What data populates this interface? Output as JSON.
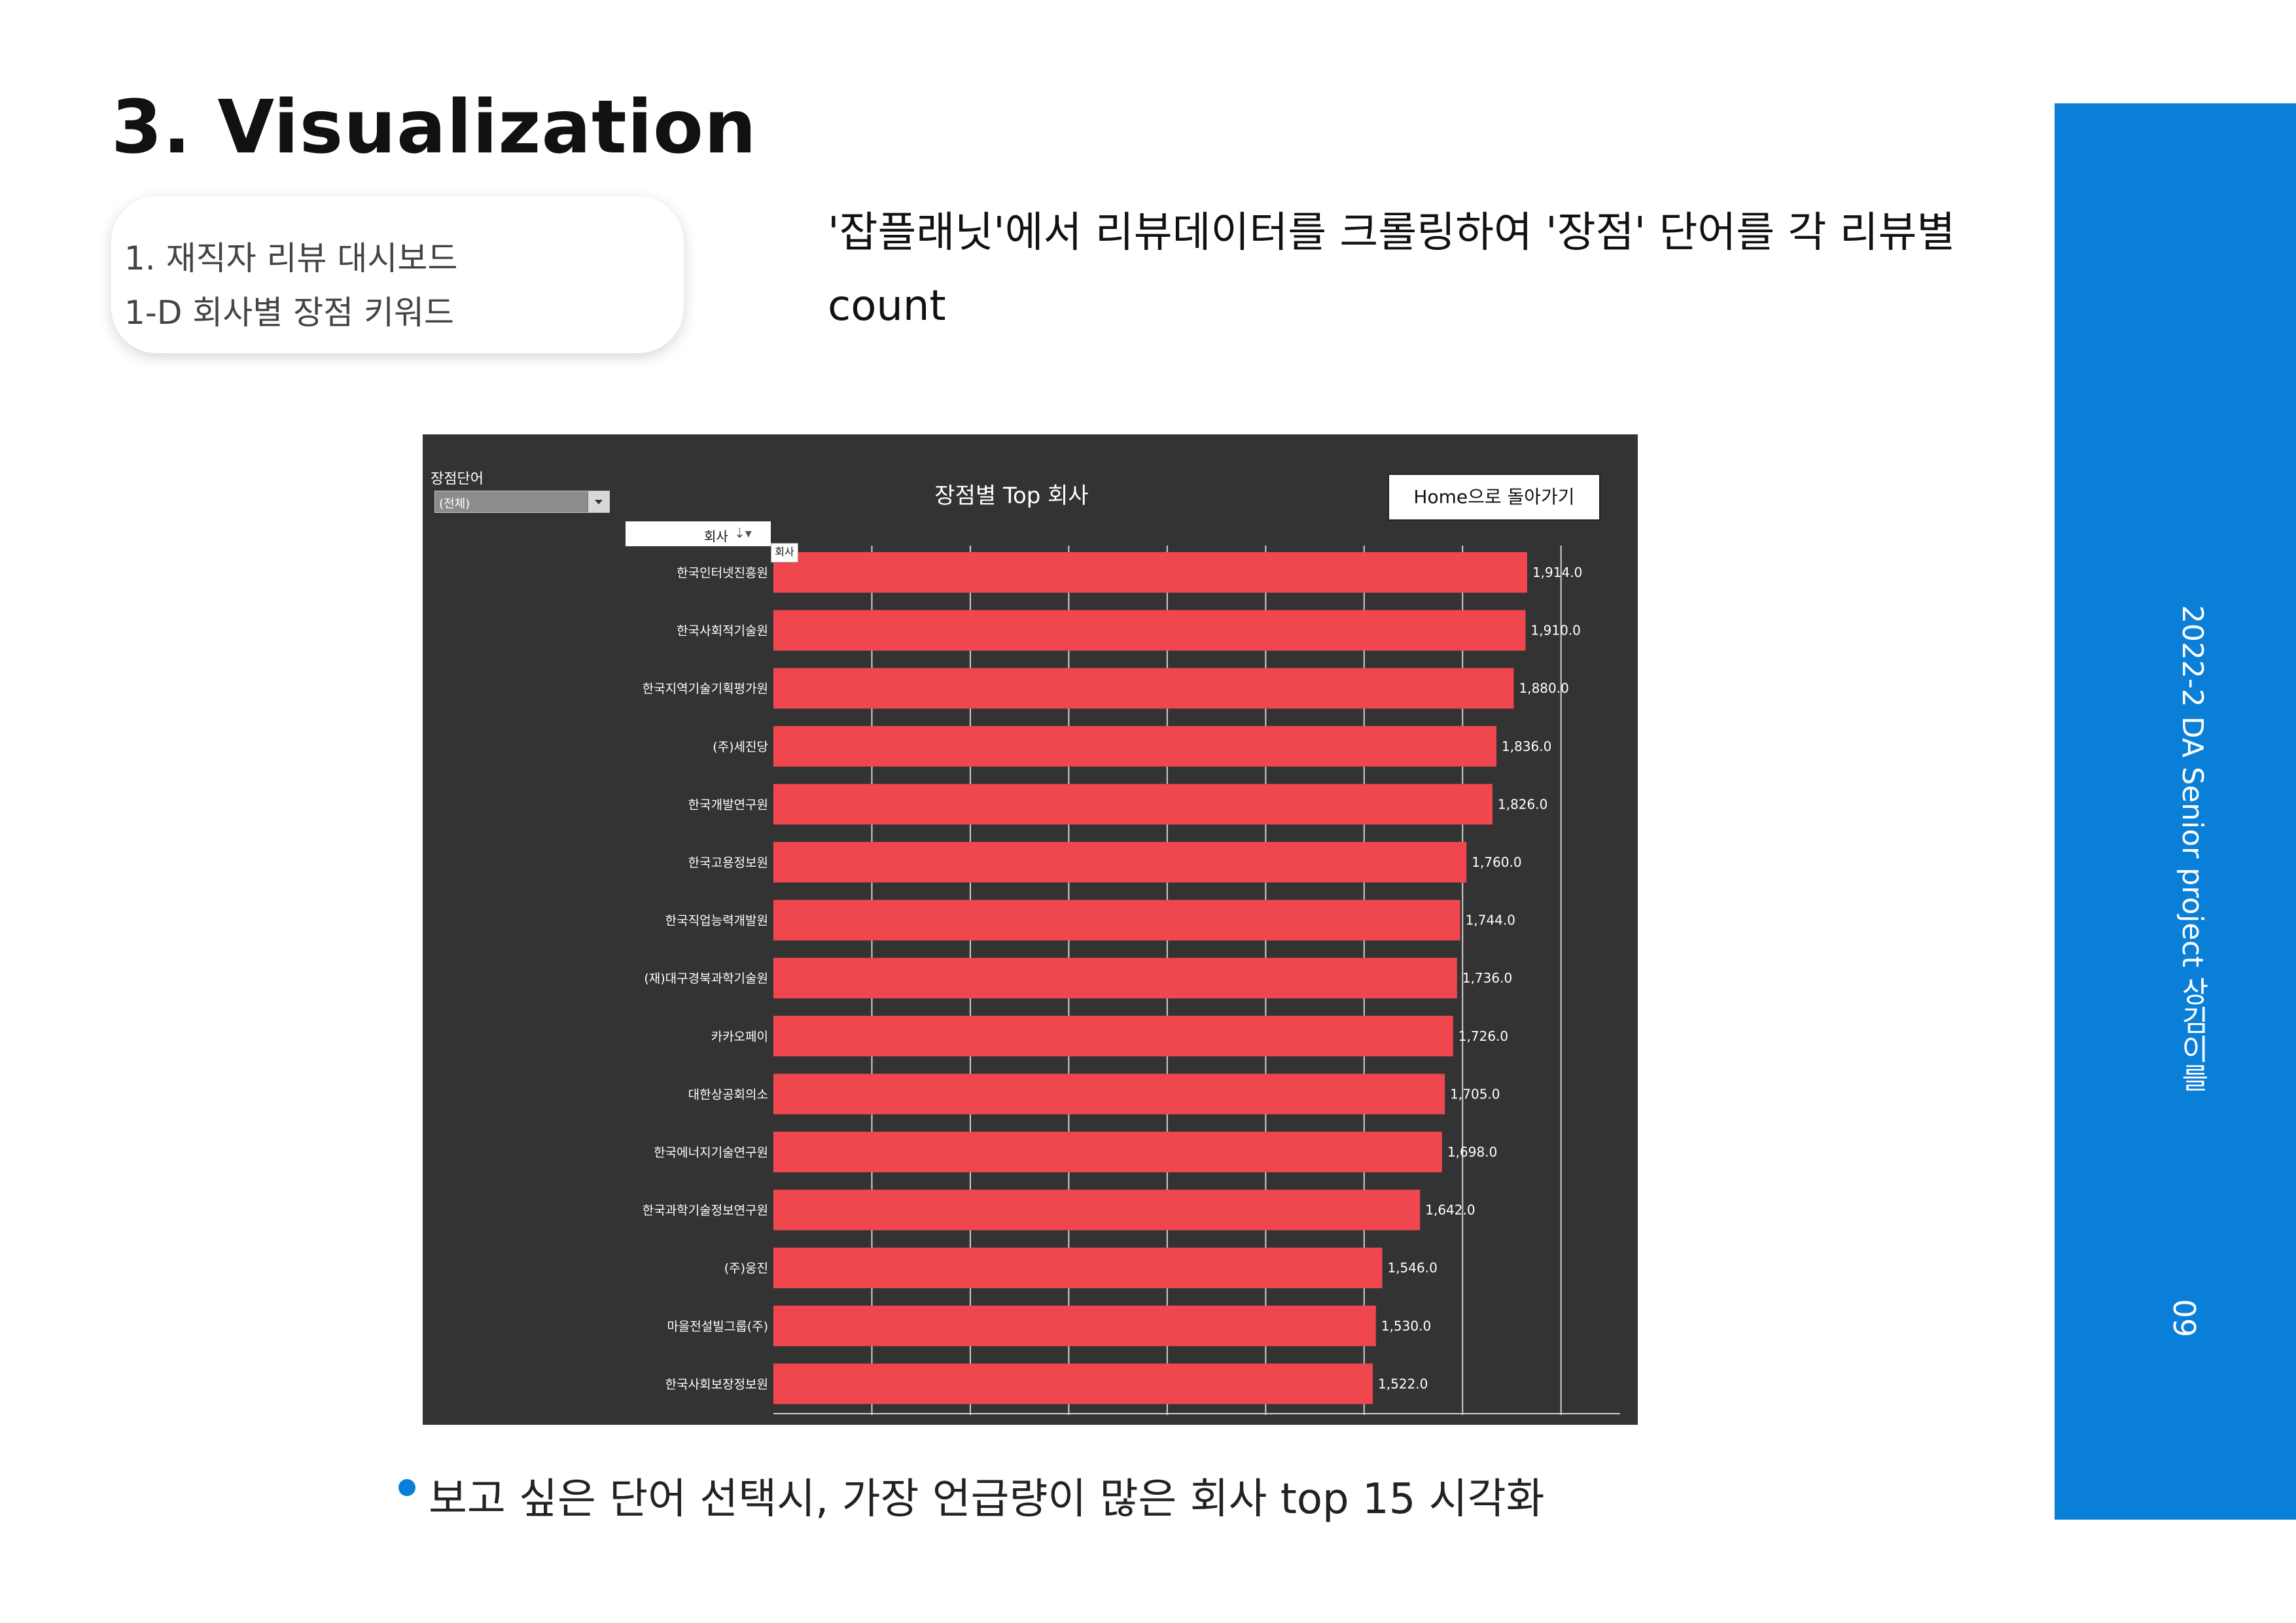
{
  "slide": {
    "title": "3. Visualization",
    "subtitle_line1": "1. 재직자 리뷰 대시보드",
    "subtitle_line2": "1-D 회사별 장점 키워드",
    "description": "'잡플래닛'에서 리뷰데이터를 크롤링하여 '장점' 단어를 각 리뷰별 count",
    "bullet": "보고 싶은 단어 선택시, 가장 언급량이 많은 회사 top 15 시각화",
    "sidebar_text": "2022-2 DA Senior project 상김이를",
    "page_number": "09",
    "accent_color": "#0a7fd7"
  },
  "dashboard": {
    "filter_label": "장점단어",
    "filter_value": "(전체)",
    "home_button_label": "Home으로 돌아가기",
    "column_header": "회사",
    "column_sort_icon": "sort-descending-icon",
    "tooltip_text": "회사",
    "bar_color": "#f0464e",
    "background_color": "#333333"
  },
  "chart_data": {
    "type": "bar",
    "orientation": "horizontal",
    "title": "장점별 Top 회사",
    "categories": [
      "한국인터넷진흥원",
      "한국사회적기술원",
      "한국지역기술기획평가원",
      "(주)세진당",
      "한국개발연구원",
      "한국고용정보원",
      "한국직업능력개발원",
      "(재)대구경북과학기술원",
      "카카오페이",
      "대한상공회의소",
      "한국에너지기술연구원",
      "한국과학기술정보연구원",
      "(주)웅진",
      "마을전설빌그룹(주)",
      "한국사회보장정보원"
    ],
    "values": [
      1914.0,
      1910.0,
      1880.0,
      1836.0,
      1826.0,
      1760.0,
      1744.0,
      1736.0,
      1726.0,
      1705.0,
      1698.0,
      1642.0,
      1546.0,
      1530.0,
      1522.0
    ],
    "value_labels": [
      "1,914.0",
      "1,910.0",
      "1,880.0",
      "1,836.0",
      "1,826.0",
      "1,760.0",
      "1,744.0",
      "1,736.0",
      "1,726.0",
      "1,705.0",
      "1,698.0",
      "1,642.0",
      "1,546.0",
      "1,530.0",
      "1,522.0"
    ],
    "xlim": [
      0,
      2150
    ],
    "grid": true,
    "xlabel": "",
    "ylabel": ""
  }
}
